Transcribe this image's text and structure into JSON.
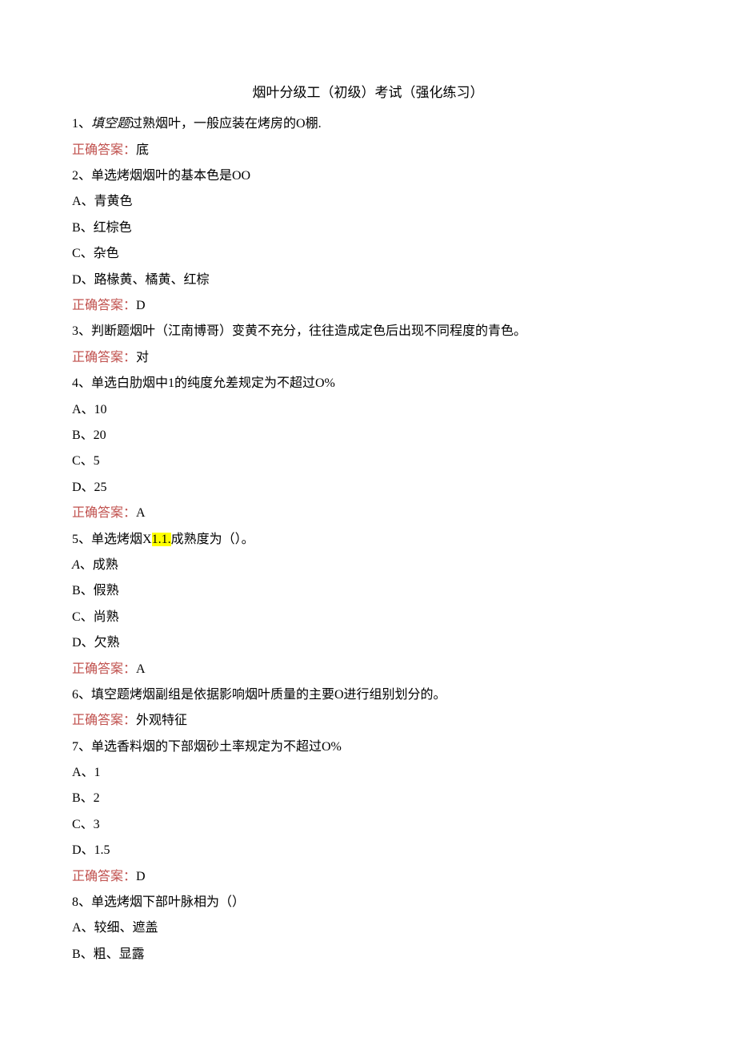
{
  "title": "烟叶分级工（初级）考试（强化练习）",
  "answer_label": "正确答案：",
  "q1": {
    "text_pre": "1、",
    "text_italic": "填空题",
    "text_post": "过熟烟叶，一般应装在烤房的O棚.",
    "answer": "底"
  },
  "q2": {
    "text": "2、单选烤烟烟叶的基本色是OO",
    "opt_a": "A、青黄色",
    "opt_b": "B、红棕色",
    "opt_c": "C、杂色",
    "opt_d": "D、路椽黄、橘黄、红棕",
    "answer": "D"
  },
  "q3": {
    "text": "3、判断题烟叶（江南博哥）变黄不充分，往往造成定色后出现不同程度的青色。",
    "answer": "对"
  },
  "q4": {
    "text": "4、单选白肋烟中1的纯度允差规定为不超过O%",
    "opt_a": "A、10",
    "opt_b": "B、20",
    "opt_c": "C、5",
    "opt_d": "D、25",
    "answer": "A"
  },
  "q5": {
    "text_pre": "5、单选烤烟X",
    "text_hl": "1.1.",
    "text_post": "成熟度为（）。",
    "opt_a_pre": "A",
    "opt_a_post": "、成熟",
    "opt_b": "B、假熟",
    "opt_c": "C、尚熟",
    "opt_d": "D、欠熟",
    "answer": "A"
  },
  "q6": {
    "text": "6、填空题烤烟副组是依据影响烟叶质量的主要O进行组别划分的。",
    "answer": "外观特征"
  },
  "q7": {
    "text": "7、单选香料烟的下部烟砂土率规定为不超过O%",
    "opt_a": "A、1",
    "opt_b": "B、2",
    "opt_c": "C、3",
    "opt_d": "D、1.5",
    "answer": "D"
  },
  "q8": {
    "text": "8、单选烤烟下部叶脉相为（）",
    "opt_a": "A、较细、遮盖",
    "opt_b": "B、粗、显露"
  }
}
